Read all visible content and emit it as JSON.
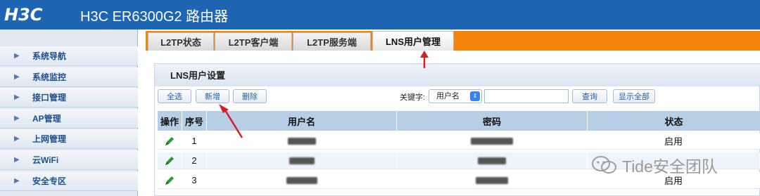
{
  "header": {
    "logo": "H3C",
    "title": "H3C ER6300G2 路由器"
  },
  "sidebar": {
    "items": [
      {
        "label": "系统导航"
      },
      {
        "label": "系统监控"
      },
      {
        "label": "接口管理"
      },
      {
        "label": "AP管理"
      },
      {
        "label": "上网管理"
      },
      {
        "label": "云WiFi"
      },
      {
        "label": "安全专区"
      }
    ]
  },
  "tabs": [
    {
      "label": "L2TP状态",
      "active": false
    },
    {
      "label": "L2TP客户端",
      "active": false
    },
    {
      "label": "L2TP服务端",
      "active": false
    },
    {
      "label": "LNS用户管理",
      "active": true
    }
  ],
  "panel": {
    "title": "LNS用户设置",
    "buttons": {
      "select_all": "全选",
      "add": "新增",
      "delete": "删除",
      "search": "查询",
      "show_all": "显示全部"
    },
    "keyword_label": "关键字:",
    "keyword_select": "用户名",
    "keyword_value": ""
  },
  "table": {
    "headers": [
      "操作",
      "序号",
      "用户名",
      "密码",
      "状态"
    ],
    "rows": [
      {
        "index": "1",
        "username": "(redacted)",
        "password": "(redacted)",
        "status": "启用"
      },
      {
        "index": "2",
        "username": "(redacted)",
        "password": "(redacted)",
        "status": ""
      },
      {
        "index": "3",
        "username": "(redacted)",
        "password": "(redacted)",
        "status": "启用"
      }
    ]
  },
  "watermark": {
    "text": "Tide安全团队"
  },
  "colors": {
    "header_blue": "#1e66b4",
    "tab_orange": "#f5840c",
    "annotation_red": "#d42020"
  }
}
